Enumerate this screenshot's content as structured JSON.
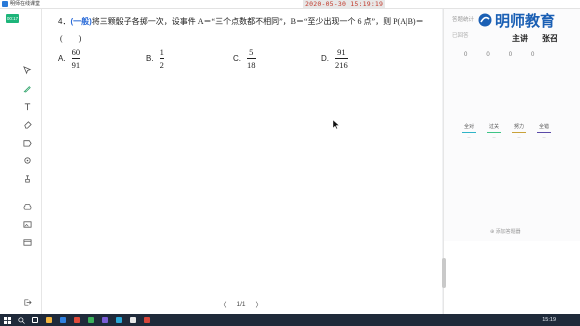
{
  "window": {
    "title": "明师在线课堂",
    "timestamp": "2020-05-30  15:19:19"
  },
  "live_badge": "00:17",
  "question": {
    "number": "4．",
    "level": "(一般)",
    "text": "将三颗骰子各掷一次，设事件 A＝“三个点数都不相同”，B＝“至少出现一个 6 点”，则 P(A|B)＝",
    "blank": "(　　)",
    "options": [
      {
        "label": "A.",
        "num": "60",
        "den": "91"
      },
      {
        "label": "B.",
        "num": "1",
        "den": "2"
      },
      {
        "label": "C.",
        "num": "5",
        "den": "18"
      },
      {
        "label": "D.",
        "num": "91",
        "den": "216"
      }
    ]
  },
  "pager": {
    "prev": "〈",
    "page": "1/1",
    "next": "〉"
  },
  "right_panel": {
    "tab_label": "答题统计",
    "sub_label": "已回答",
    "logo_text": "明师教育",
    "lecturer_label": "主讲",
    "lecturer_name": "张召",
    "counts": [
      "0",
      "0",
      "0",
      "0"
    ],
    "categories": [
      {
        "label": "全对",
        "dash": "--",
        "color": "#2fb4c7"
      },
      {
        "label": "过关",
        "dash": "--",
        "color": "#3ec486"
      },
      {
        "label": "努力",
        "dash": "--",
        "color": "#c9a23a"
      },
      {
        "label": "全错",
        "dash": "--",
        "color": "#5a4aa8"
      }
    ],
    "add_question": "添加答题器"
  },
  "taskbar": {
    "time": "15:19"
  }
}
